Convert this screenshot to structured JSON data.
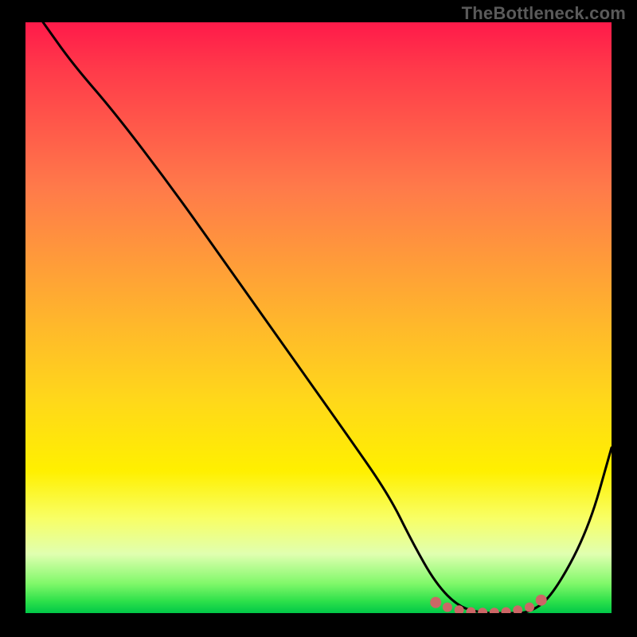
{
  "watermark": "TheBottleneck.com",
  "colors": {
    "frame": "#000000",
    "gradient_top": "#ff1a4a",
    "gradient_bottom": "#00c848",
    "curve": "#000000",
    "markers": "#cc6666"
  },
  "chart_data": {
    "type": "line",
    "title": "",
    "xlabel": "",
    "ylabel": "",
    "xlim": [
      0,
      100
    ],
    "ylim": [
      0,
      100
    ],
    "grid": false,
    "legend": false,
    "series": [
      {
        "name": "bottleneck-curve",
        "x": [
          3,
          8,
          15,
          25,
          35,
          45,
          55,
          62,
          66,
          70,
          74,
          78,
          82,
          86,
          90,
          96,
          100
        ],
        "y": [
          100,
          93,
          85,
          72,
          58,
          44,
          30,
          20,
          12,
          5,
          1,
          0,
          0,
          0,
          3,
          14,
          28
        ]
      }
    ],
    "markers": {
      "name": "optimal-range",
      "x": [
        70,
        72,
        74,
        76,
        78,
        80,
        82,
        84,
        86,
        88
      ],
      "y": [
        1.8,
        1.0,
        0.5,
        0.2,
        0.1,
        0.1,
        0.2,
        0.5,
        1.0,
        2.2
      ]
    }
  }
}
